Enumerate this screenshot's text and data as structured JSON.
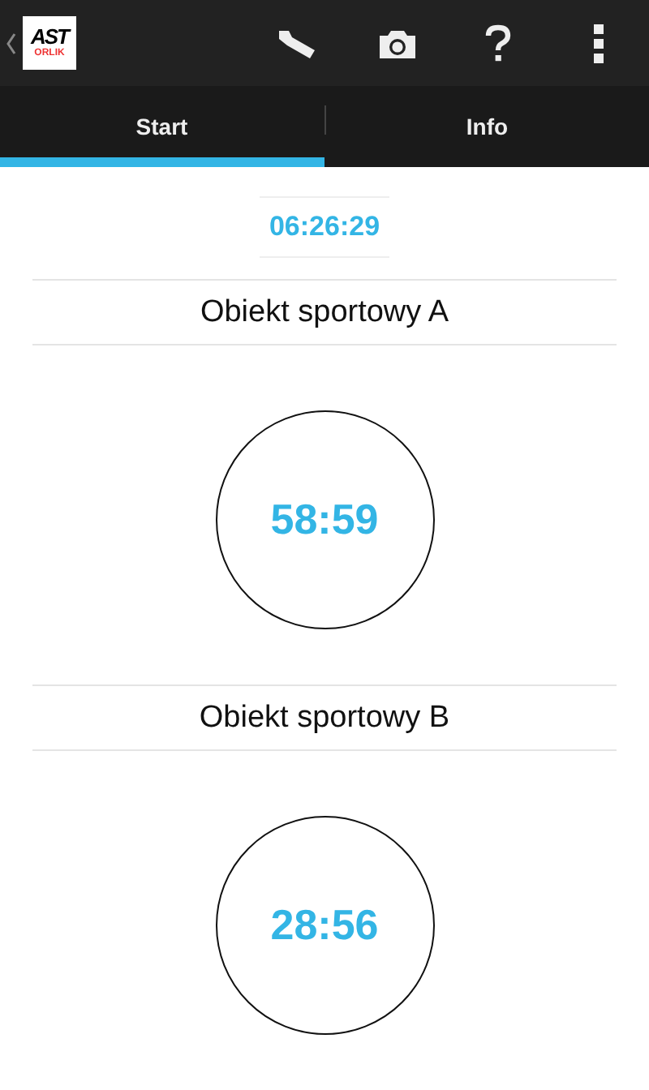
{
  "action_bar": {
    "logo_top": "AST",
    "logo_bottom": "ORLIK"
  },
  "tabs": [
    {
      "label": "Start",
      "selected": true
    },
    {
      "label": "Info",
      "selected": false
    }
  ],
  "clock": "06:26:29",
  "venues": [
    {
      "name": "Obiekt sportowy A",
      "timer": "58:59"
    },
    {
      "name": "Obiekt sportowy B",
      "timer": "28:56"
    }
  ]
}
